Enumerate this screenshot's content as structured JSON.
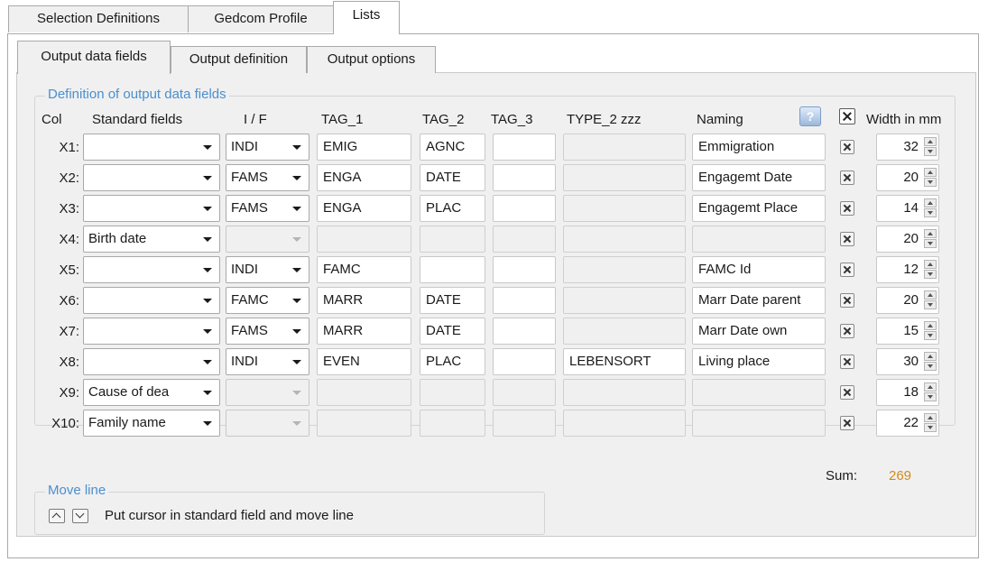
{
  "tabs_top": [
    "Selection Definitions",
    "Gedcom Profile",
    "Lists"
  ],
  "tabs_sub": [
    "Output data fields",
    "Output definition",
    "Output options"
  ],
  "group_title": "Definition of output data fields",
  "headers": {
    "col": "Col",
    "standard": "Standard fields",
    "if": "I / F",
    "tag1": "TAG_1",
    "tag2": "TAG_2",
    "tag3": "TAG_3",
    "type2": "TYPE_2 zzz",
    "naming": "Naming",
    "width": "Width in mm"
  },
  "help_icon": "?",
  "rows": [
    {
      "col": "X1:",
      "standard": "",
      "if": "INDI",
      "tag1": "EMIG",
      "tag2": "AGNC",
      "tag3": "",
      "type2": "",
      "naming": "Emmigration",
      "width": "32"
    },
    {
      "col": "X2:",
      "standard": "",
      "if": "FAMS",
      "tag1": "ENGA",
      "tag2": "DATE",
      "tag3": "",
      "type2": "",
      "naming": "Engagemt Date",
      "width": "20"
    },
    {
      "col": "X3:",
      "standard": "",
      "if": "FAMS",
      "tag1": "ENGA",
      "tag2": "PLAC",
      "tag3": "",
      "type2": "",
      "naming": "Engagemt Place",
      "width": "14"
    },
    {
      "col": "X4:",
      "standard": "Birth date",
      "if": "",
      "tag1": "",
      "tag2": "",
      "tag3": "",
      "type2": "",
      "naming": "",
      "width": "20"
    },
    {
      "col": "X5:",
      "standard": "",
      "if": "INDI",
      "tag1": "FAMC",
      "tag2": "",
      "tag3": "",
      "type2": "",
      "naming": "FAMC Id",
      "width": "12"
    },
    {
      "col": "X6:",
      "standard": "",
      "if": "FAMC",
      "tag1": "MARR",
      "tag2": "DATE",
      "tag3": "",
      "type2": "",
      "naming": "Marr Date parent",
      "width": "20"
    },
    {
      "col": "X7:",
      "standard": "",
      "if": "FAMS",
      "tag1": "MARR",
      "tag2": "DATE",
      "tag3": "",
      "type2": "",
      "naming": "Marr Date own",
      "width": "15"
    },
    {
      "col": "X8:",
      "standard": "",
      "if": "INDI",
      "tag1": "EVEN",
      "tag2": "PLAC",
      "tag3": "",
      "type2": "LEBENSORT",
      "naming": "Living place",
      "width": "30"
    },
    {
      "col": "X9:",
      "standard": "Cause of dea",
      "if": "",
      "tag1": "",
      "tag2": "",
      "tag3": "",
      "type2": "",
      "naming": "",
      "width": "18"
    },
    {
      "col": "X10:",
      "standard": "Family name",
      "if": "",
      "tag1": "",
      "tag2": "",
      "tag3": "",
      "type2": "",
      "naming": "",
      "width": "22"
    }
  ],
  "move": {
    "title": "Move line",
    "hint": "Put cursor in standard field and move line"
  },
  "sum": {
    "label": "Sum:",
    "value": "269",
    "value_color": "#d08a1e"
  },
  "colors": {
    "group_title": "#4a8fd0"
  }
}
